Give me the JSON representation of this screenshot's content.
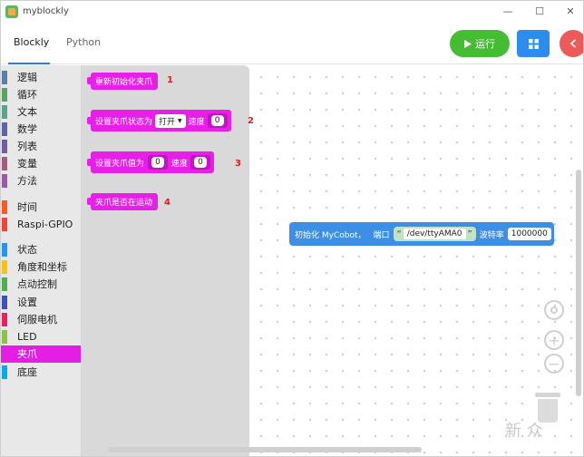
{
  "app": {
    "title": "myblockly"
  },
  "window_controls": {
    "minimize": "—",
    "maximize": "☐",
    "close": "✕"
  },
  "tabs": [
    {
      "label": "Blockly"
    },
    {
      "label": "Python"
    }
  ],
  "toolbar": {
    "run_label": "运行"
  },
  "categories": [
    {
      "label": "逻辑",
      "color": "#5b80a5"
    },
    {
      "label": "循环",
      "color": "#5ba55b"
    },
    {
      "label": "文本",
      "color": "#5ba58c"
    },
    {
      "label": "数学",
      "color": "#5b67a5"
    },
    {
      "label": "列表",
      "color": "#745ba5"
    },
    {
      "label": "变量",
      "color": "#a55b80"
    },
    {
      "label": "方法",
      "color": "#995ba5"
    },
    {
      "label": "时间",
      "color": "#ff5722"
    },
    {
      "label": "Raspi-GPIO",
      "color": "#f44336"
    },
    {
      "label": "状态",
      "color": "#2196f3"
    },
    {
      "label": "角度和坐标",
      "color": "#ffc107"
    },
    {
      "label": "点动控制",
      "color": "#4caf50"
    },
    {
      "label": "设置",
      "color": "#3f51b5"
    },
    {
      "label": "伺服电机",
      "color": "#e91e63"
    },
    {
      "label": "LED",
      "color": "#8bc34a"
    },
    {
      "label": "夹爪",
      "color": "#e51ee5"
    },
    {
      "label": "底座",
      "color": "#03a9f4"
    }
  ],
  "flyout_blocks": {
    "b1": {
      "label": "重新初始化夹爪",
      "annotation": "1"
    },
    "b2": {
      "label": "设置夹爪状态为",
      "dropdown": "打开",
      "speed_label": "速度",
      "speed_value": "0",
      "annotation": "2"
    },
    "b3": {
      "label": "设置夹爪值为",
      "value": "0",
      "speed_label": "速度",
      "speed_value": "0",
      "annotation": "3"
    },
    "b4": {
      "label": "夹爪是否在运动",
      "annotation": "4"
    }
  },
  "workspace_block": {
    "label": "初始化 MyCobot，",
    "port_label": "端口",
    "port_value": "/dev/ttyAMA0",
    "quote_open": "“",
    "quote_close": "”",
    "baud_label": "波特率",
    "baud_value": "1000000"
  },
  "watermark": "新 众"
}
